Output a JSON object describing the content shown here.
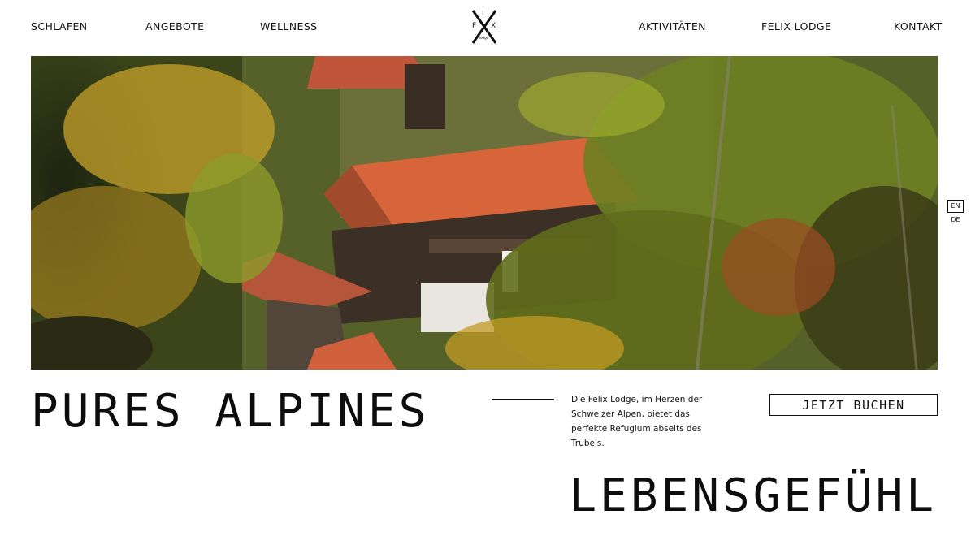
{
  "nav": {
    "left": [
      "SCHLAFEN",
      "ANGEBOTE",
      "WELLNESS"
    ],
    "right": [
      "AKTIVITÄTEN",
      "FELIX LODGE",
      "KONTAKT"
    ]
  },
  "logo": {
    "letters": [
      "L",
      "F",
      "X"
    ],
    "tagline": "lodge"
  },
  "language": {
    "options": [
      "EN",
      "DE"
    ],
    "active": "EN"
  },
  "headline": {
    "line1": "PURES ALPINES",
    "line2": "LEBENSGEFÜHL"
  },
  "intro": "Die Felix Lodge, im Herzen der Schweizer Alpen, bietet das perfekte Refugium abseits des Trubels.",
  "cta": {
    "book_label": "JETZT BUCHEN"
  },
  "colors": {
    "roof": "#d8643a",
    "foliage": "#7a8a2a",
    "autumn": "#c9921e",
    "text": "#111111"
  }
}
